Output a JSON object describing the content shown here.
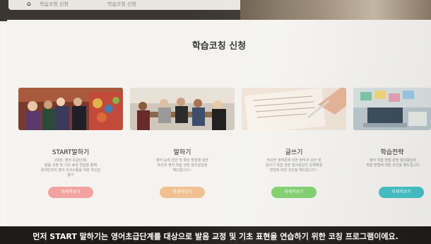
{
  "browser": {
    "tab_texts": [
      "학습코칭 신청",
      "학습코칭 신청"
    ]
  },
  "page": {
    "title": "학습코칭 신청"
  },
  "cards": [
    {
      "title": "START말하기",
      "desc_lines": [
        "(대상: 영어 초급단계)",
        "발음 교정 및 기초 표현 연습을 통해",
        "원어민과의 영어 의사소통을 위한 자신감",
        "향기"
      ],
      "button": "자세히보기",
      "button_color": "#f2a3a0"
    },
    {
      "title": "말하기",
      "desc_lines": [
        "영어 능력 진단 및 향상 방법에 대한",
        "조언과 영어 학습 관련 질의응답을",
        "해드립니다~"
      ],
      "button": "자세히보기",
      "button_color": "#f0c08f"
    },
    {
      "title": "글쓰기",
      "desc_lines": [
        "작성한 영작문에 대한 첨삭과 조언 및",
        "글쓰기 학습 관련 질의응답과 문제해결",
        "방법에 대한 조언을 해드립니다~"
      ],
      "button": "자세히보기",
      "button_color": "#7fcf6c"
    },
    {
      "title": "학습전략",
      "desc_lines": [
        "영어 학습 방법 관련 질의응답과",
        "학습 방법에 대한 조언을 해드립니다"
      ],
      "button": "자세히보기",
      "button_color": "#43c1c7"
    }
  ],
  "subtitle": "먼저 START 말하기는 영어초급단계를 대상으로 발음 교정 및 기초 표현을 연습하기 위한 코칭 프로그램이에요."
}
